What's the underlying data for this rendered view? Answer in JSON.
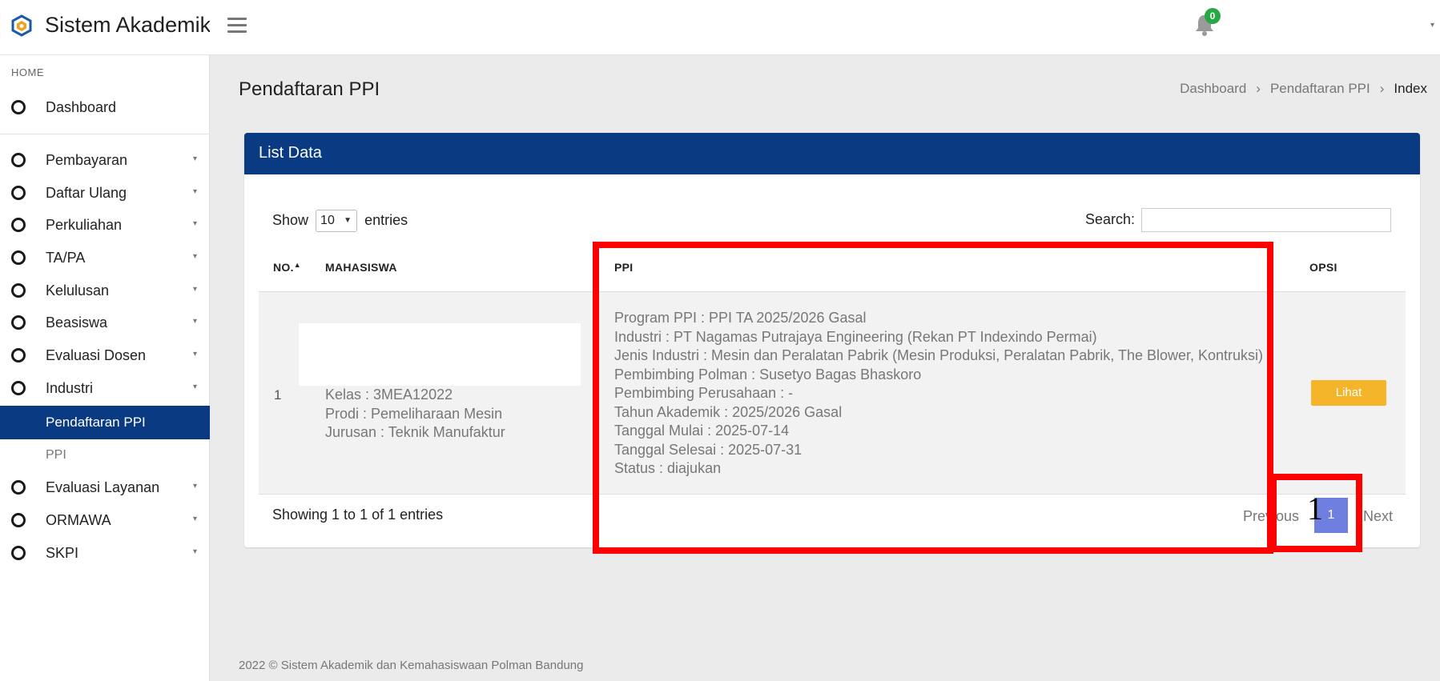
{
  "app": {
    "title": "Sistem Akademik"
  },
  "header": {
    "notification_count": "0"
  },
  "sidebar": {
    "section_home": "HOME",
    "items": [
      {
        "label": "Dashboard"
      },
      {
        "label": "Pembayaran"
      },
      {
        "label": "Daftar Ulang"
      },
      {
        "label": "Perkuliahan"
      },
      {
        "label": "TA/PA"
      },
      {
        "label": "Kelulusan"
      },
      {
        "label": "Beasiswa"
      },
      {
        "label": "Evaluasi Dosen"
      },
      {
        "label": "Industri"
      },
      {
        "label": "Evaluasi Layanan"
      },
      {
        "label": "ORMAWA"
      },
      {
        "label": "SKPI"
      }
    ],
    "sub_items": [
      {
        "label": "Pendaftaran PPI"
      },
      {
        "label": "PPI"
      }
    ]
  },
  "page": {
    "title": "Pendaftaran PPI",
    "breadcrumb": [
      "Dashboard",
      "Pendaftaran PPI",
      "Index"
    ]
  },
  "card": {
    "title": "List Data",
    "show_label": "Show",
    "entries_label": "entries",
    "page_size": "10",
    "search_label": "Search:",
    "search_value": "",
    "columns": [
      "NO.",
      "MAHASISWA",
      "PPI",
      "OPSI"
    ],
    "row": {
      "no": "1",
      "mahasiswa": [
        "Kelas : 3MEA12022",
        "Prodi : Pemeliharaan Mesin",
        "Jurusan : Teknik Manufaktur"
      ],
      "ppi": [
        "Program PPI : PPI TA 2025/2026 Gasal",
        "Industri : PT Nagamas Putrajaya Engineering (Rekan PT Indexindo Permai)",
        "Jenis Industri : Mesin dan Peralatan Pabrik (Mesin Produksi, Peralatan Pabrik, The Blower, Kontruksi)",
        "Pembimbing Polman : Susetyo Bagas Bhaskoro",
        "Pembimbing Perusahaan : -",
        "Tahun Akademik : 2025/2026 Gasal",
        "Tanggal Mulai : 2025-07-14",
        "Tanggal Selesai : 2025-07-31",
        "Status : diajukan"
      ],
      "action": "Lihat"
    },
    "info": "Showing 1 to 1 of 1 entries",
    "pagination": {
      "previous": "Previous",
      "current": "1",
      "next": "Next"
    }
  },
  "annotation": {
    "label": "1",
    "color": "#ff0000"
  },
  "footer": {
    "text": "2022 © Sistem Akademik dan Kemahasiswaan Polman Bandung"
  },
  "colors": {
    "primary": "#0a3a82",
    "warning": "#f5b52b",
    "page_active": "#6f7fdf",
    "badge": "#28a745"
  }
}
